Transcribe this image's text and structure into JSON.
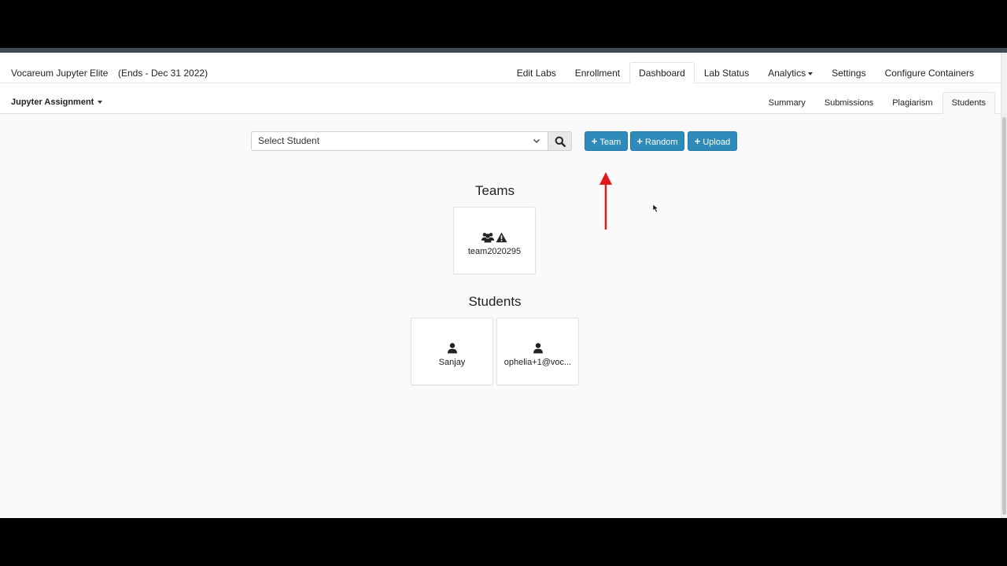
{
  "header": {
    "brand": "Vocareum Jupyter Elite",
    "term": "(Ends - Dec 31 2022)",
    "nav": [
      {
        "label": "Edit Labs",
        "active": false
      },
      {
        "label": "Enrollment",
        "active": false
      },
      {
        "label": "Dashboard",
        "active": true
      },
      {
        "label": "Lab Status",
        "active": false
      },
      {
        "label": "Analytics",
        "active": false,
        "dropdown": true
      },
      {
        "label": "Settings",
        "active": false
      },
      {
        "label": "Configure Containers",
        "active": false
      }
    ]
  },
  "subheader": {
    "assignment": "Jupyter Assignment",
    "tabs": [
      {
        "label": "Summary",
        "active": false
      },
      {
        "label": "Submissions",
        "active": false
      },
      {
        "label": "Plagiarism",
        "active": false
      },
      {
        "label": "Students",
        "active": true
      }
    ]
  },
  "toolbar": {
    "select_student": "Select Student",
    "team_label": "Team",
    "random_label": "Random",
    "upload_label": "Upload"
  },
  "teams": {
    "title": "Teams",
    "items": [
      {
        "name": "team2020295",
        "icons": [
          "users-icon",
          "warning-icon"
        ]
      }
    ]
  },
  "students": {
    "title": "Students",
    "items": [
      {
        "name": "Sanjay",
        "icon": "user-icon"
      },
      {
        "name": "ophelia+1@voc...",
        "icon": "user-icon"
      }
    ]
  },
  "colors": {
    "primary_button": "#2d8ab9",
    "annotation_arrow": "#e01b1b"
  }
}
